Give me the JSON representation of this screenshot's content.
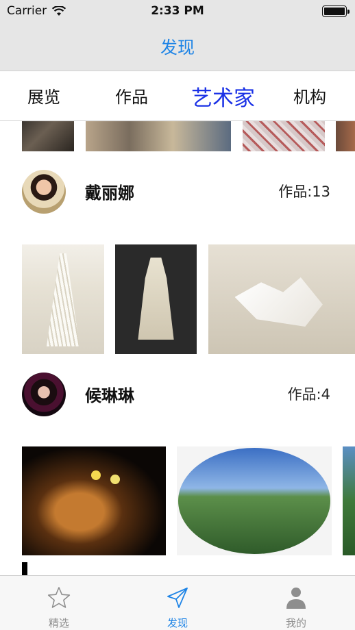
{
  "status_bar": {
    "carrier": "Carrier",
    "time": "2:33 PM"
  },
  "nav": {
    "title": "发现"
  },
  "category_tabs": [
    {
      "label": "展览",
      "active": false
    },
    {
      "label": "作品",
      "active": false
    },
    {
      "label": "艺术家",
      "active": true
    },
    {
      "label": "机构",
      "active": false
    }
  ],
  "artists": [
    {
      "name": "戴丽娜",
      "works": "作品:13"
    },
    {
      "name": "候琳琳",
      "works": "作品:4"
    }
  ],
  "bottom_tabs": [
    {
      "label": "精选",
      "icon": "star-icon",
      "active": false
    },
    {
      "label": "发现",
      "icon": "paper-plane-icon",
      "active": true
    },
    {
      "label": "我的",
      "icon": "person-icon",
      "active": false
    }
  ],
  "colors": {
    "accent": "#1e84e6",
    "active_tab": "#1a31e6",
    "inactive": "#8e8e8e"
  }
}
